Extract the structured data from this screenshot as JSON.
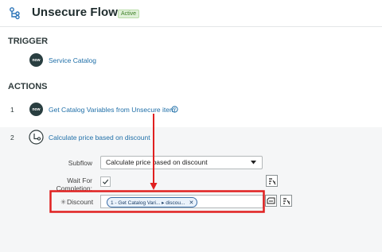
{
  "header": {
    "title": "Unsecure Flow",
    "status_badge": "Active",
    "flow_icon": "flow-tree-icon"
  },
  "trigger": {
    "heading": "TRIGGER",
    "icon_text": "now",
    "label": "Service Catalog"
  },
  "actions": {
    "heading": "ACTIONS",
    "items": [
      {
        "number": "1",
        "icon_text": "now",
        "label": "Get Catalog Variables from Unsecure item",
        "help_icon": "help-circle-icon"
      },
      {
        "number": "2",
        "icon": "subflow-icon",
        "label": "Calculate price based on discount"
      }
    ]
  },
  "subflow_form": {
    "subflow_label": "Subflow",
    "subflow_value": "Calculate price based on discount",
    "wait_label": "Wait For Completion:",
    "wait_checked": true,
    "discount_label": "Discount",
    "discount_required_marker": "✳",
    "pill_text": "1 - Get Catalog Vari... ▸ discou...",
    "pill_remove": "✕"
  },
  "colors": {
    "annotation_red": "#e02020",
    "link_blue": "#1f6fa8",
    "active_green": "#3a7d22"
  }
}
